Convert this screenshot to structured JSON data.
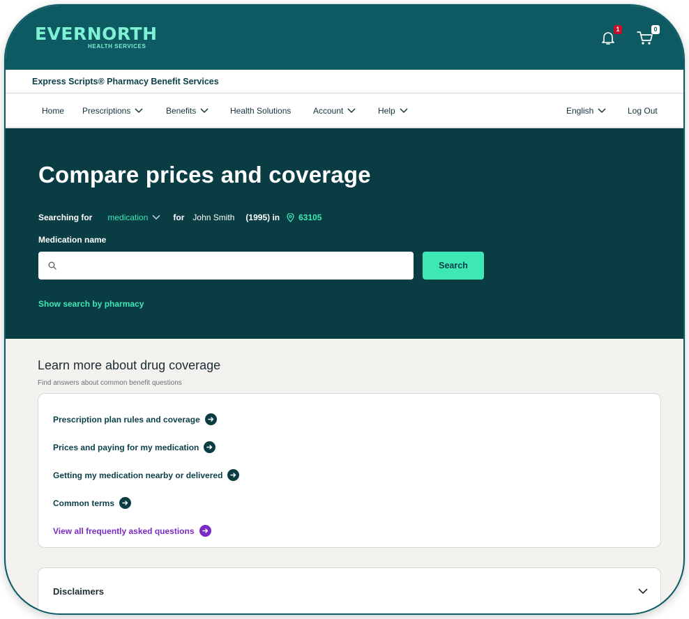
{
  "brand": {
    "logo_text": "EVERNORTH",
    "logo_sub": "HEALTH SERVICES",
    "notification_count": "1",
    "cart_count": "0",
    "subbrand": "Express Scripts® Pharmacy Benefit Services"
  },
  "nav": {
    "home": "Home",
    "prescriptions": "Prescriptions",
    "benefits": "Benefits",
    "health_solutions": "Health Solutions",
    "account": "Account",
    "help": "Help",
    "language": "English",
    "logout": "Log Out"
  },
  "hero": {
    "title": "Compare prices and coverage",
    "searching_for_label": "Searching for",
    "search_type": "medication",
    "for_label": "for",
    "member_name": "John Smith",
    "member_year": "(1995) in",
    "zip": "63105",
    "medication_label": "Medication name",
    "search_placeholder": "",
    "search_button": "Search",
    "pharmacy_link": "Show search by pharmacy"
  },
  "learn": {
    "title": "Learn more about drug coverage",
    "subtitle": "Find answers about common benefit questions",
    "links": [
      "Prescription plan rules and coverage",
      "Prices and paying for my medication",
      "Getting my medication nearby or delivered",
      "Common terms"
    ],
    "faq_link": "View all frequently asked questions"
  },
  "disclaimers": {
    "label": "Disclaimers"
  },
  "colors": {
    "brand_teal": "#0e5a62",
    "hero_bg": "#0a3c44",
    "accent_green": "#3ee8b5",
    "link_purple": "#7a2bc2"
  }
}
